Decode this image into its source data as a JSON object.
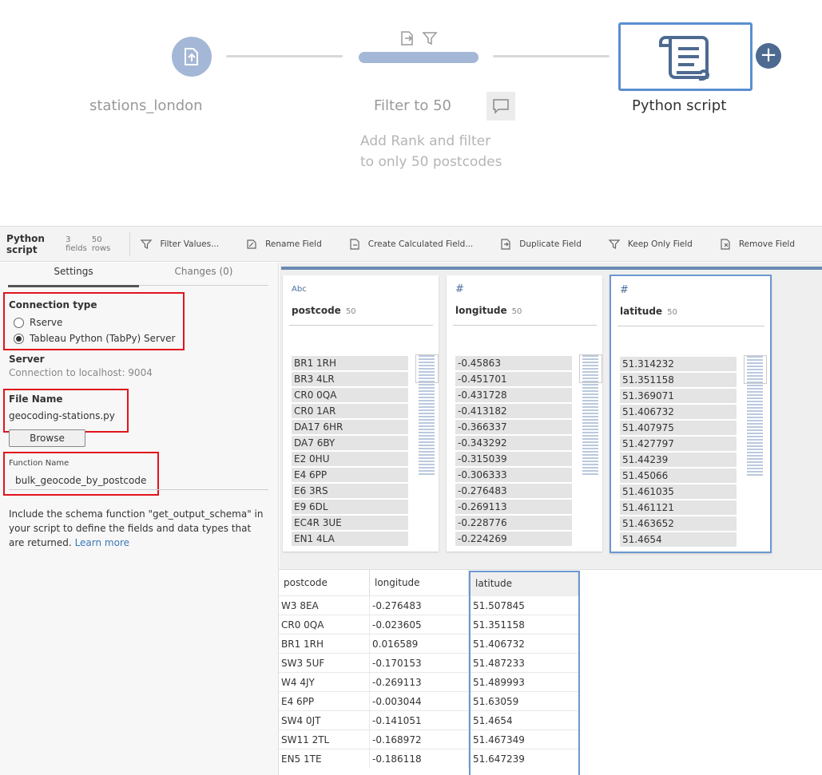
{
  "flow": {
    "input_node": {
      "label": "stations_london",
      "icon": "input-file-icon"
    },
    "filter_node": {
      "label": "Filter to 50",
      "icons": [
        "calculated-field-icon",
        "filter-icon"
      ],
      "description_line1": "Add Rank and filter",
      "description_line2": "to only 50 postcodes"
    },
    "script_node": {
      "label": "Python script",
      "icon": "script-scroll-icon"
    },
    "add_button": "+"
  },
  "toolbar": {
    "title": "Python script",
    "meta_fields": "3 fields",
    "meta_rows": "50 rows",
    "actions": [
      "Filter Values...",
      "Rename Field",
      "Create Calculated Field...",
      "Duplicate Field",
      "Keep Only Field",
      "Remove Field"
    ]
  },
  "settings": {
    "tab_settings": "Settings",
    "tab_changes": "Changes (0)",
    "connection_type_label": "Connection type",
    "option_rserve": "Rserve",
    "option_tabpy": "Tableau Python (TabPy) Server",
    "selected_option": "Tableau Python (TabPy) Server",
    "server_label": "Server",
    "server_value": "Connection to localhost: 9004",
    "file_name_label": "File Name",
    "file_name_value": "geocoding-stations.py",
    "browse_button": "Browse",
    "function_name_label": "Function Name",
    "function_name_value": "bulk_geocode_by_postcode",
    "help_text": "Include the schema function \"get_output_schema\" in your script to define the fields and data types that are returned.",
    "learn_more": "Learn more"
  },
  "profile": {
    "cards": [
      {
        "type": "Abc",
        "name": "postcode",
        "count": "50",
        "values": [
          "BR1 1RH",
          "BR3 4LR",
          "CR0 0QA",
          "CR0 1AR",
          "DA17 6HR",
          "DA7 6BY",
          "E2 0HU",
          "E4 6PP",
          "E6 3RS",
          "E9 6DL",
          "EC4R 3UE",
          "EN1 4LA"
        ]
      },
      {
        "type": "#",
        "name": "longitude",
        "count": "50",
        "values": [
          "-0.45863",
          "-0.451701",
          "-0.431728",
          "-0.413182",
          "-0.366337",
          "-0.343292",
          "-0.315039",
          "-0.306333",
          "-0.276483",
          "-0.269113",
          "-0.228776",
          "-0.224269"
        ]
      },
      {
        "type": "#",
        "name": "latitude",
        "count": "50",
        "values": [
          "51.314232",
          "51.351158",
          "51.369071",
          "51.406732",
          "51.407975",
          "51.427797",
          "51.44239",
          "51.45066",
          "51.461035",
          "51.461121",
          "51.463652",
          "51.4654"
        ]
      }
    ]
  },
  "grid": {
    "headers": [
      "postcode",
      "longitude",
      "latitude"
    ],
    "rows": [
      [
        "W3 8EA",
        "-0.276483",
        "51.507845"
      ],
      [
        "CR0 0QA",
        "-0.023605",
        "51.351158"
      ],
      [
        "BR1 1RH",
        "0.016589",
        "51.406732"
      ],
      [
        "SW3 5UF",
        "-0.170153",
        "51.487233"
      ],
      [
        "W4 4JY",
        "-0.269113",
        "51.489993"
      ],
      [
        "E4 6PP",
        "-0.003044",
        "51.63059"
      ],
      [
        "SW4 0JT",
        "-0.141051",
        "51.4654"
      ],
      [
        "SW11 2TL",
        "-0.168972",
        "51.467349"
      ],
      [
        "EN5 1TE",
        "-0.186118",
        "51.647239"
      ]
    ]
  }
}
